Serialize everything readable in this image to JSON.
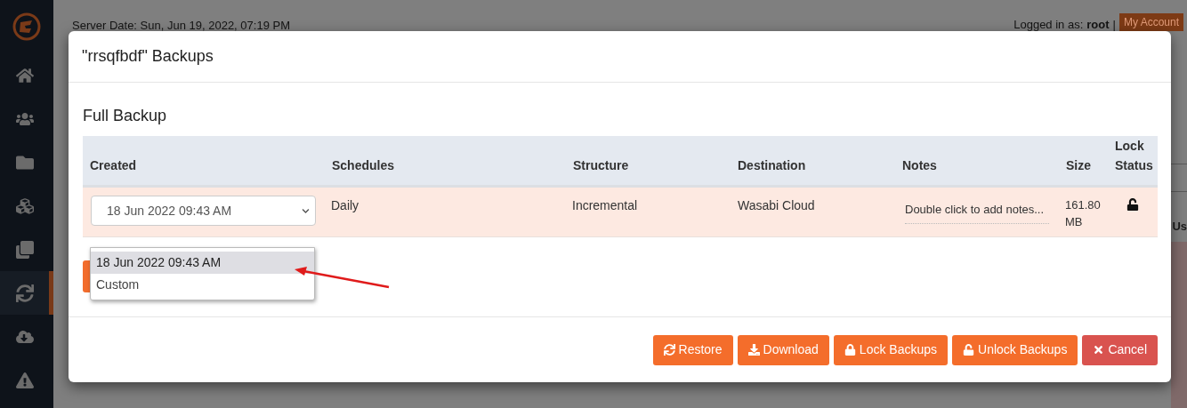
{
  "header": {
    "server_date": "Server Date: Sun, Jun 19, 2022, 07:19 PM",
    "logged_in_label": "Logged in as:",
    "user": "root",
    "separator": "|",
    "account_button": "My Account"
  },
  "sidebar": {
    "items": [
      {
        "kind": "home",
        "selected": false
      },
      {
        "kind": "users",
        "selected": false
      },
      {
        "kind": "folder",
        "selected": false
      },
      {
        "kind": "cubes",
        "selected": false
      },
      {
        "kind": "clone",
        "selected": false
      },
      {
        "kind": "sync",
        "selected": true
      },
      {
        "kind": "cloud",
        "selected": false
      },
      {
        "kind": "warning",
        "selected": false
      }
    ]
  },
  "background": {
    "column_fragment": "Us"
  },
  "modal": {
    "title": "\"rrsqfbdf\" Backups",
    "section_title": "Full Backup",
    "table": {
      "columns": [
        "Created",
        "Schedules",
        "Structure",
        "Destination",
        "Notes",
        "Size",
        "Lock Status"
      ],
      "rows": [
        {
          "created": "18 Jun 2022 09:43 AM",
          "schedules": "Daily",
          "structure": "Incremental",
          "destination": "Wasabi Cloud",
          "notes_placeholder": "Double click to add notes...",
          "size": "161.80 MB",
          "locked": false
        }
      ]
    },
    "dropdown": {
      "options": [
        {
          "label": "18 Jun 2022 09:43 AM",
          "selected": true
        },
        {
          "label": "Custom",
          "selected": false
        }
      ]
    },
    "buttons": [
      {
        "label": "Restore",
        "kind": "restore"
      },
      {
        "label": "Download",
        "kind": "download"
      },
      {
        "label": "Lock Backups",
        "kind": "lock"
      },
      {
        "label": "Unlock Backups",
        "kind": "unlock"
      },
      {
        "label": "Cancel",
        "kind": "cancel"
      }
    ]
  }
}
